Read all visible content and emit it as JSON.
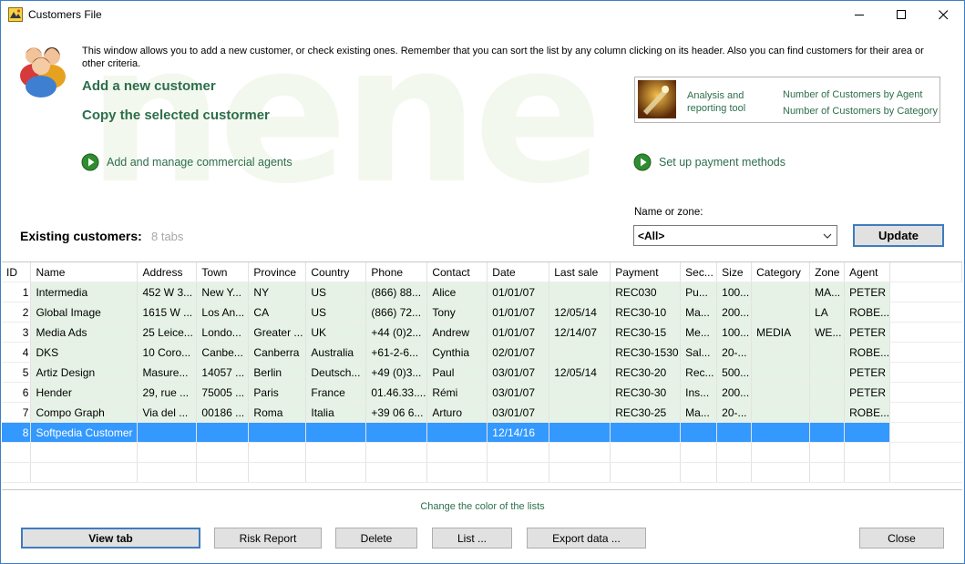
{
  "window": {
    "title": "Customers File",
    "watermark": "nene"
  },
  "intro": "This window allows you to add a new customer, or check existing ones. Remember that you can sort the list by any column clicking on its header. Also you can find customers for their area or other criteria.",
  "actions": {
    "add_customer": "Add a new customer",
    "copy_customer": "Copy the selected custormer",
    "manage_agents": "Add and manage commercial agents",
    "payment_methods": "Set up payment methods"
  },
  "report": {
    "title_line1": "Analysis and",
    "title_line2": "reporting tool",
    "link_agent": "Number of Customers by Agent",
    "link_category": "Number of Customers by Category"
  },
  "existing": {
    "label": "Existing customers:",
    "count": "8 tabs"
  },
  "filter": {
    "label": "Name or zone:",
    "value": "<All>",
    "update": "Update"
  },
  "table": {
    "columns": [
      "ID",
      "Name",
      "Address",
      "Town",
      "Province",
      "Country",
      "Phone",
      "Contact",
      "Date",
      "Last sale",
      "Payment",
      "Sec...",
      "Size",
      "Category",
      "Zone",
      "Agent"
    ],
    "rows": [
      [
        "1",
        "Intermedia",
        "452 W 3...",
        "New Y...",
        "NY",
        "US",
        "(866) 88...",
        "Alice",
        "01/01/07",
        "",
        "REC030",
        "Pu...",
        "100...",
        "",
        "MA...",
        "PETER"
      ],
      [
        "2",
        "Global Image",
        "1615 W ...",
        "Los An...",
        "CA",
        "US",
        "(866) 72...",
        "Tony",
        "01/01/07",
        "12/05/14",
        "REC30-10",
        "Ma...",
        "200...",
        "",
        "LA",
        "ROBE..."
      ],
      [
        "3",
        "Media Ads",
        "25 Leice...",
        "Londo...",
        "Greater ...",
        "UK",
        "+44 (0)2...",
        "Andrew",
        "01/01/07",
        "12/14/07",
        "REC30-15",
        "Me...",
        "100...",
        "MEDIA",
        "WE...",
        "PETER"
      ],
      [
        "4",
        "DKS",
        "10 Coro...",
        "Canbe...",
        "Canberra",
        "Australia",
        "+61-2-6...",
        "Cynthia",
        "02/01/07",
        "",
        "REC30-1530",
        "Sal...",
        "20-...",
        "",
        "",
        "ROBE..."
      ],
      [
        "5",
        "Artiz Design",
        "Masure...",
        "14057 ...",
        "Berlin",
        "Deutsch...",
        "+49 (0)3...",
        "Paul",
        "03/01/07",
        "12/05/14",
        "REC30-20",
        "Rec...",
        "500...",
        "",
        "",
        "PETER"
      ],
      [
        "6",
        "Hender",
        "29, rue ...",
        "75005 ...",
        "Paris",
        "France",
        "01.46.33....",
        "Rémi",
        "03/01/07",
        "",
        "REC30-30",
        "Ins...",
        "200...",
        "",
        "",
        "PETER"
      ],
      [
        "7",
        "Compo Graph",
        "Via del ...",
        "00186 ...",
        "Roma",
        "Italia",
        "+39 06 6...",
        "Arturo",
        "03/01/07",
        "",
        "REC30-25",
        "Ma...",
        "20-...",
        "",
        "",
        "ROBE..."
      ],
      [
        "8",
        "Softpedia Customer",
        "",
        "",
        "",
        "",
        "",
        "",
        "12/14/16",
        "",
        "",
        "",
        "",
        "",
        "",
        ""
      ]
    ]
  },
  "footer": {
    "color_link": "Change the color of the lists",
    "view_tab": "View tab",
    "risk_report": "Risk Report",
    "delete": "Delete",
    "list": "List ...",
    "export": "Export data ...",
    "close": "Close"
  },
  "colors": {
    "accent_green": "#2d6e4b",
    "row_green": "#e6f2e6",
    "selection": "#3399ff",
    "focus_border": "#3e7cbf"
  }
}
